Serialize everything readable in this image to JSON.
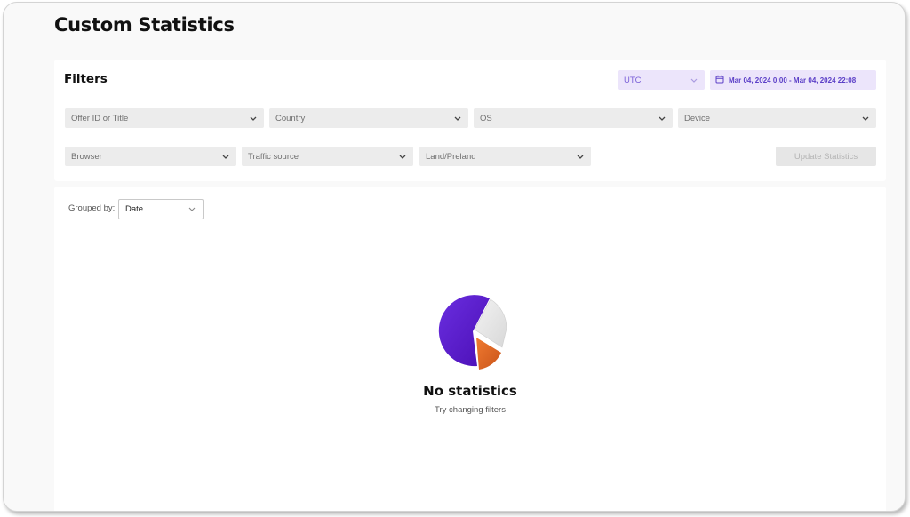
{
  "page": {
    "title": "Custom Statistics"
  },
  "filters": {
    "title": "Filters",
    "timezone": {
      "value": "UTC"
    },
    "date_range": {
      "value": "Mar 04, 2024 0:00 - Mar 04, 2024 22:08"
    },
    "offer": {
      "placeholder": "Offer ID or Title"
    },
    "country": {
      "placeholder": "Country"
    },
    "os": {
      "placeholder": "OS"
    },
    "device": {
      "placeholder": "Device"
    },
    "browser": {
      "placeholder": "Browser"
    },
    "traffic_source": {
      "placeholder": "Traffic source"
    },
    "land_preland": {
      "placeholder": "Land/Preland"
    },
    "update_label": "Update Statistics"
  },
  "results": {
    "grouped_label": "Grouped by:",
    "grouped_value": "Date",
    "empty": {
      "icon": "pie-chart-icon",
      "title": "No statistics",
      "subtitle": "Try changing filters"
    }
  },
  "colors": {
    "accent": "#5b3fc7",
    "accent_bg": "#ece5fb",
    "pie_primary": "#5a17c9",
    "pie_secondary": "#e2e2e2",
    "pie_highlight": "#e06a25"
  }
}
